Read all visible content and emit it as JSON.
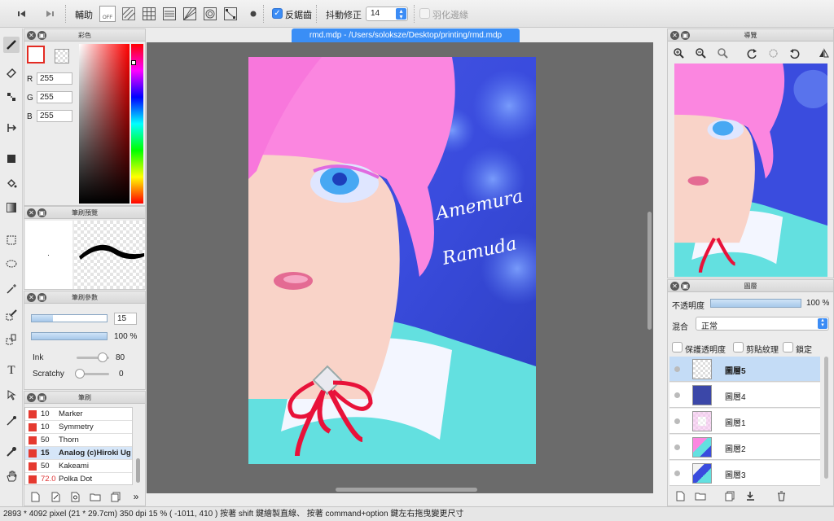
{
  "toolbar": {
    "assist_label": "輔助",
    "antialias_label": "反鋸齒",
    "antialias_checked": true,
    "stabilizer_label": "抖動修正",
    "stabilizer_value": "14",
    "feather_label": "羽化邊緣",
    "feather_checked": false,
    "off_label": "OFF"
  },
  "document": {
    "title": "rmd.mdp - /Users/soloksze/Desktop/printing/rmd.mdp"
  },
  "color_panel": {
    "title": "彩色",
    "r_label": "R",
    "r_value": "255",
    "g_label": "G",
    "g_value": "255",
    "b_label": "B",
    "b_value": "255",
    "fg_color": "#ffffff",
    "accent": "#ff0000"
  },
  "brush_preview": {
    "title": "筆刷預覽"
  },
  "brush_params": {
    "title": "筆刷參數",
    "size_value": "15",
    "opacity_value": "100 %",
    "ink_label": "Ink",
    "ink_value": "80",
    "scratchy_label": "Scratchy",
    "scratchy_value": "0",
    "size_fill": 0.28,
    "opacity_fill": 1.0,
    "ink_level": 0.8,
    "scratchy_level": 0.0
  },
  "brush_list": {
    "title": "筆刷",
    "items": [
      {
        "size": "10",
        "name": "Marker",
        "selected": false
      },
      {
        "size": "10",
        "name": "Symmetry",
        "selected": false
      },
      {
        "size": "50",
        "name": "Thorn",
        "selected": false
      },
      {
        "size": "15",
        "name": "Analog (c)Hiroki Ug",
        "selected": true
      },
      {
        "size": "50",
        "name": "Kakeami",
        "selected": false
      },
      {
        "size": "72.0",
        "name": "Polka Dot",
        "selected": false
      }
    ]
  },
  "navigator": {
    "title": "導覽"
  },
  "artwork": {
    "signature_line1": "Amemura",
    "signature_line2": "Ramuda"
  },
  "layers_panel": {
    "title": "圖層",
    "opacity_label": "不透明度",
    "opacity_value": "100 %",
    "opacity_fill": 1.0,
    "blend_label": "混合",
    "blend_value": "正常",
    "protect_alpha_label": "保護透明度",
    "clipping_label": "剪貼紋理",
    "lock_label": "鎖定",
    "layers": [
      {
        "name": "圖層5",
        "selected": true,
        "thumb": "checker"
      },
      {
        "name": "圖層4",
        "selected": false,
        "thumb": "#3b47a8"
      },
      {
        "name": "圖層1",
        "selected": false,
        "thumb": "sketch"
      },
      {
        "name": "圖層2",
        "selected": false,
        "thumb": "art"
      },
      {
        "name": "圖層3",
        "selected": false,
        "thumb": "art2"
      }
    ]
  },
  "status": {
    "text": "2893 * 4092 pixel  (21 * 29.7cm)  350 dpi  15 %  ( -1011, 410 )  按著 shift 鍵繪製直線、 按著 command+option 鍵左右拖曳變更尺寸"
  }
}
